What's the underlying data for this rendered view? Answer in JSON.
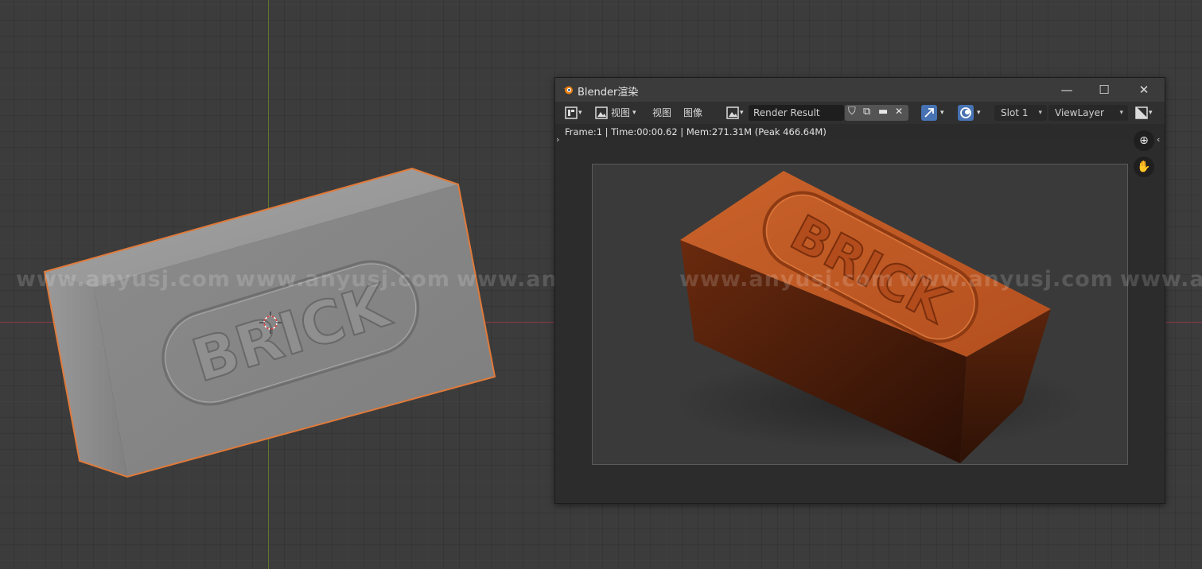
{
  "viewport": {
    "watermarks": [
      "www.anyusj.com",
      "www.anyusj.com",
      "www.anyusj.com",
      "www.anyusj.com",
      "www.anyusj.com",
      "www.anyusj.com"
    ],
    "object_text": "BRICK"
  },
  "render_window": {
    "title": "Blender渲染",
    "controls": {
      "minimize": "—",
      "maximize": "☐",
      "close": "✕"
    },
    "header": {
      "view_menu": "视图",
      "view_label": "视图",
      "image_label": "图像",
      "image_name": "Render Result",
      "slot": "Slot 1",
      "view_layer": "ViewLayer"
    },
    "stats": "Frame:1 | Time:00:00.62 | Mem:271.31M (Peak 466.64M)",
    "render_text": "BRICK"
  },
  "colors": {
    "brick_render": "#b4501f",
    "clay": "#8c8c8c",
    "selection_outline": "#e07a3a",
    "accent_blue": "#4772b3"
  }
}
